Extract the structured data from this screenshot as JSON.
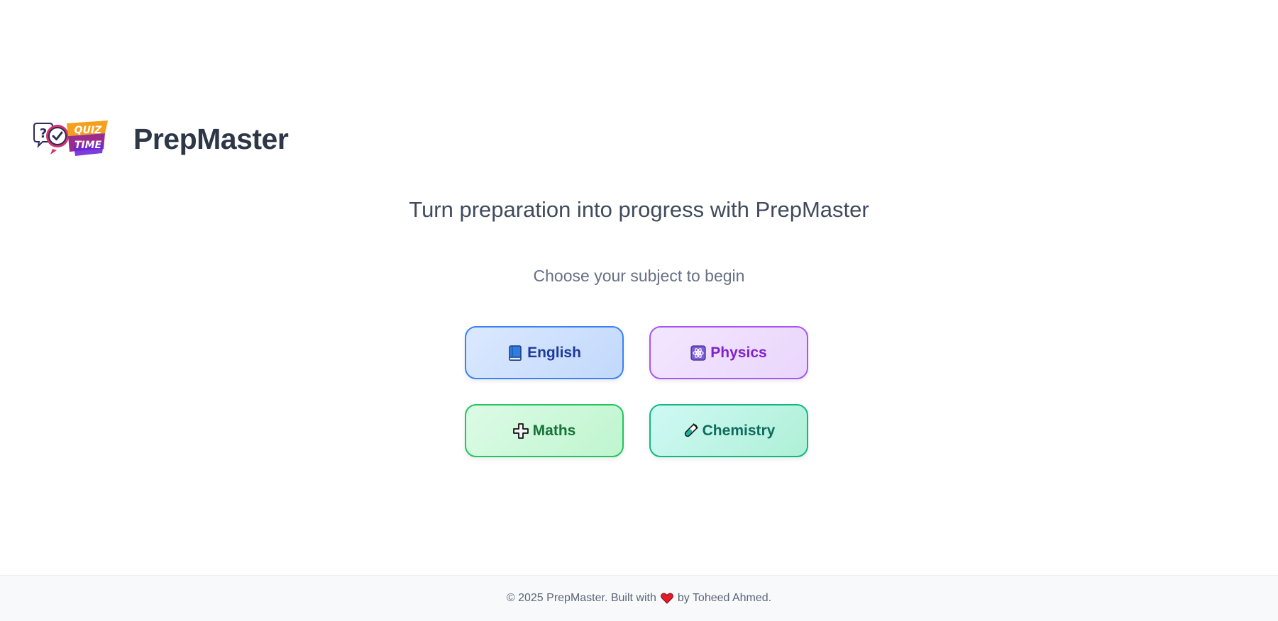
{
  "brand": {
    "logo_text_line1": "QUIZ",
    "logo_text_line2": "TIME",
    "name": "PrepMaster"
  },
  "hero": {
    "tagline": "Turn preparation into progress with PrepMaster",
    "subtitle": "Choose your subject to begin"
  },
  "subjects": [
    {
      "label": "English",
      "icon": "blue-book-icon",
      "color": "#3b82f6"
    },
    {
      "label": "Physics",
      "icon": "atom-icon",
      "color": "#a855f7"
    },
    {
      "label": "Maths",
      "icon": "plus-icon",
      "color": "#22c55e"
    },
    {
      "label": "Chemistry",
      "icon": "test-tube-icon",
      "color": "#10b981"
    }
  ],
  "footer": {
    "before_heart": "© 2025 PrepMaster. Built with",
    "heart_icon": "heart-icon",
    "after_heart": "by Toheed Ahmed."
  }
}
